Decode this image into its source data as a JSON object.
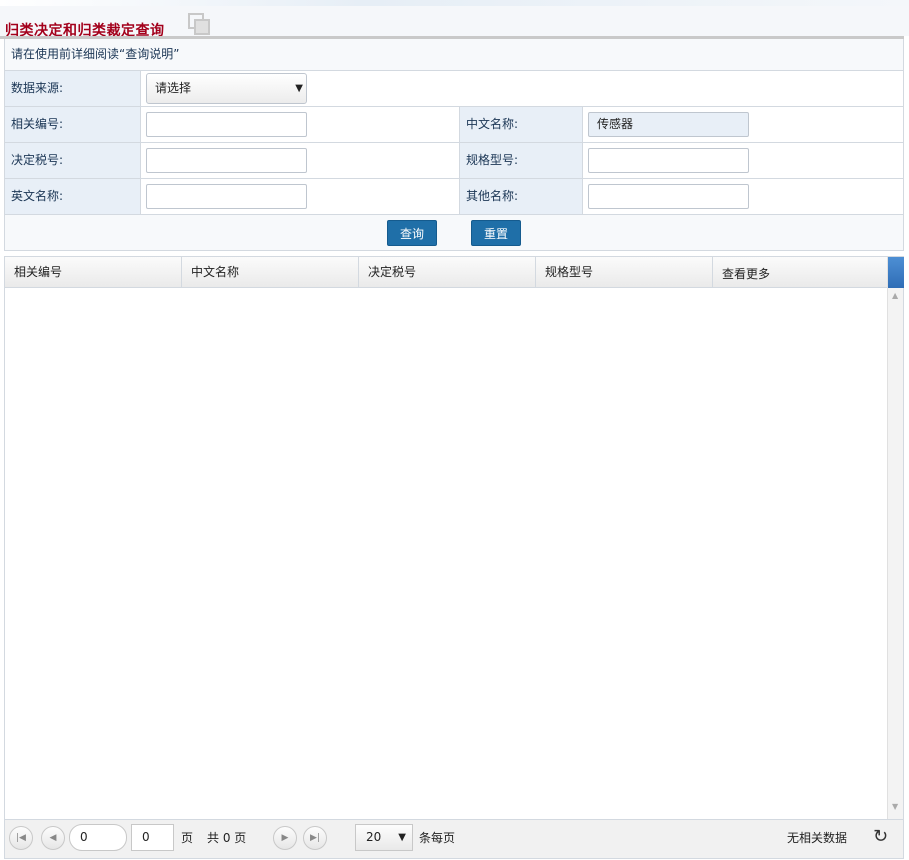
{
  "page": {
    "title": "归类决定和归类裁定查询"
  },
  "form": {
    "notice": "请在使用前详细阅读“查询说明”",
    "source_label": "数据来源:",
    "source_value": "请选择",
    "rel_no_label": "相关编号:",
    "rel_no_value": "",
    "cn_name_label": "中文名称:",
    "cn_name_value": "传感器",
    "tax_no_label": "决定税号:",
    "tax_no_value": "",
    "spec_label": "规格型号:",
    "spec_value": "",
    "en_name_label": "英文名称:",
    "en_name_value": "",
    "other_label": "其他名称:",
    "other_value": "",
    "query_button": "查询",
    "reset_button": "重置"
  },
  "grid": {
    "columns": [
      "相关编号",
      "中文名称",
      "决定税号",
      "规格型号",
      "查看更多"
    ],
    "rows": []
  },
  "pager": {
    "page_input": "0",
    "page_number": "0",
    "page_label": "页",
    "total_text": "共 0 页",
    "page_size": "20",
    "per_page_label": "条每页",
    "status": "无相关数据"
  }
}
